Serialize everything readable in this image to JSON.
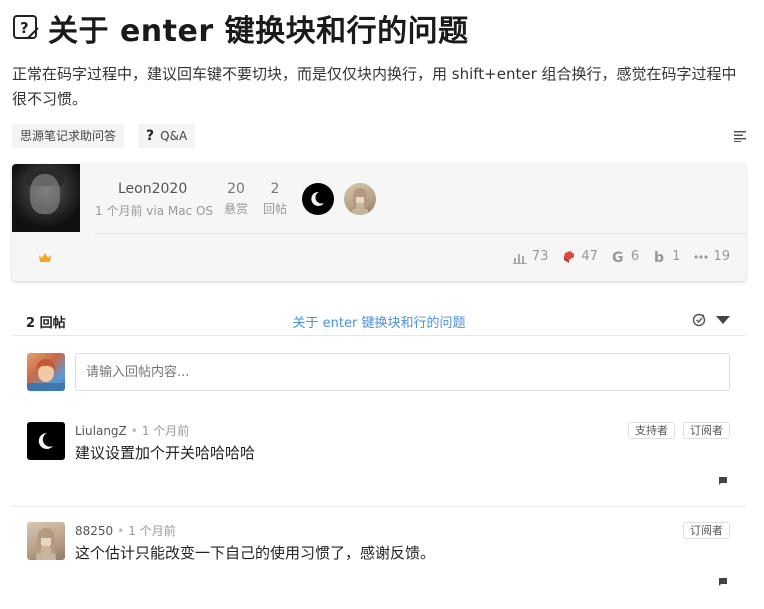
{
  "post": {
    "title": "关于 enter 键换块和行的问题",
    "description": "正常在码字过程中，建议回车键不要切块，而是仅仅块内换行，用 shift+enter 组合换行，感觉在码字过程中很不习惯。",
    "tags": [
      {
        "label": "思源笔记求助问答"
      },
      {
        "label": "Q&A",
        "icon": "question-mark-icon"
      }
    ],
    "author": "Leon2020",
    "meta": "1 个月前 via Mac OS",
    "reward": {
      "num": "20",
      "label": "悬赏"
    },
    "replies": {
      "num": "2",
      "label": "回帖"
    },
    "stats": {
      "views": "73",
      "thanks": "47",
      "g": "6",
      "b": "1",
      "more": "19"
    }
  },
  "reply_header": {
    "count": "2 回帖",
    "title": "关于 enter 键换块和行的问题"
  },
  "editor": {
    "placeholder": "请输入回帖内容..."
  },
  "replies": [
    {
      "name": "LiulangZ",
      "time": "1 个月前",
      "body": "建议设置加个开关哈哈哈哈",
      "badges": [
        "支持者",
        "订阅者"
      ],
      "avatar": "moon-avatar"
    },
    {
      "name": "88250",
      "time": "1 个月前",
      "body": "这个估计只能改变一下自己的使用习惯了，感谢反馈。",
      "badges": [
        "订阅者"
      ],
      "avatar": "girl-avatar"
    }
  ],
  "colors": {
    "accent": "#4a90e2",
    "crown": "#f5a623",
    "card_bg": "#f6f6f6"
  }
}
